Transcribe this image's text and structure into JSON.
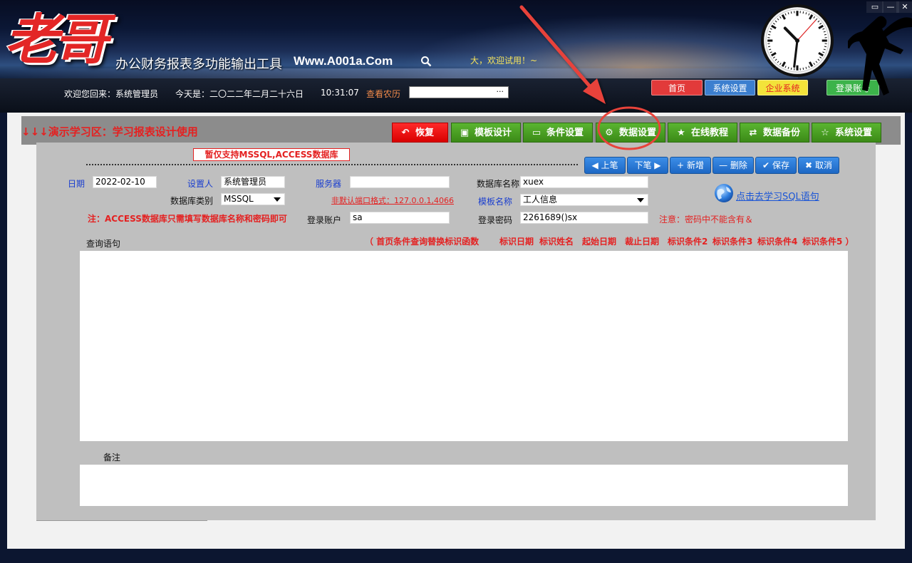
{
  "header": {
    "logo_text": "老哥",
    "app_title": "办公财务报表多功能输出工具",
    "site_url": "Www.A001a.Com",
    "welcome_try": "大，欢迎试用！~",
    "welcome_back": "欢迎您回来：系统管理员",
    "today": "今天是：二〇二二年二月二十六日",
    "time": "10:31:07",
    "lunar_link": "查看农历",
    "lunar_input_dots": "···",
    "window_controls": [
      "▭",
      "—",
      "✕"
    ],
    "top_buttons": [
      {
        "label": "首页",
        "color": "#e23a3a"
      },
      {
        "label": "系统设置",
        "color": "#3c7fcf"
      },
      {
        "label": "企业系统",
        "color": "#f3e33a",
        "text_color": "#e42121"
      },
      {
        "label": "登录账号",
        "color": "#3cb34a"
      }
    ],
    "clock": {
      "hour": 10,
      "minute": 31,
      "second": 7
    }
  },
  "main": {
    "demo_label": "↓↓↓演示学习区：学习报表设计使用",
    "tabs": [
      {
        "label": "恢复",
        "icon": "undo-icon",
        "glyph": "↶"
      },
      {
        "label": "模板设计",
        "icon": "template-icon",
        "glyph": "▣"
      },
      {
        "label": "条件设置",
        "icon": "window-icon",
        "glyph": "▭"
      },
      {
        "label": "数据设置",
        "icon": "gear-icon",
        "glyph": "⚙"
      },
      {
        "label": "在线教程",
        "icon": "star-icon",
        "glyph": "★"
      },
      {
        "label": "数据备份",
        "icon": "sync-icon",
        "glyph": "⇄"
      },
      {
        "label": "系统设置",
        "icon": "star-outline-icon",
        "glyph": "☆"
      }
    ],
    "notice": "暂仅支持MSSQL,ACCESS数据库",
    "nav_buttons": [
      {
        "label": "上笔",
        "glyph": "◀"
      },
      {
        "label": "下笔",
        "glyph": "▶"
      },
      {
        "label": "新增",
        "glyph": "+"
      },
      {
        "label": "删除",
        "glyph": "—"
      },
      {
        "label": "保存",
        "glyph": "✔"
      },
      {
        "label": "取消",
        "glyph": "✖"
      }
    ],
    "form": {
      "date_label": "日期",
      "date_value": "2022-02-10",
      "setter_label": "设置人",
      "setter_value": "系统管理员",
      "server_label": "服务器",
      "server_value": "",
      "dbname_label": "数据库名称",
      "dbname_value": "xuex",
      "dbtype_label": "数据库类别",
      "dbtype_value": "MSSQL",
      "port_hint": "非默认端口格式：127.0.0.1,4066",
      "template_label": "模板名称",
      "template_value": "工人信息",
      "access_note": "注：ACCESS数据库只需填写数据库名称和密码即可",
      "account_label": "登录账户",
      "account_value": "sa",
      "password_label": "登录密码",
      "password_value": "2261689()sx",
      "password_note": "注意：密码中不能含有＆",
      "sql_link": "点击去学习SQL语句",
      "query_label": "查询语句",
      "token_intro": "（ 首页条件查询替换标识函数",
      "tokens": [
        "标识日期",
        "标识姓名",
        "起始日期",
        "裁止日期",
        "标识条件2",
        "标识条件3",
        "标识条件4",
        "标识条件5 ）"
      ],
      "query_value": "",
      "remark_label": "备注",
      "remark_value": ""
    }
  },
  "colors": {
    "accent_red": "#e42121",
    "tab_green": "#4a9d22",
    "nav_blue": "#2a7ad9",
    "annotation_red": "#e8433a"
  }
}
